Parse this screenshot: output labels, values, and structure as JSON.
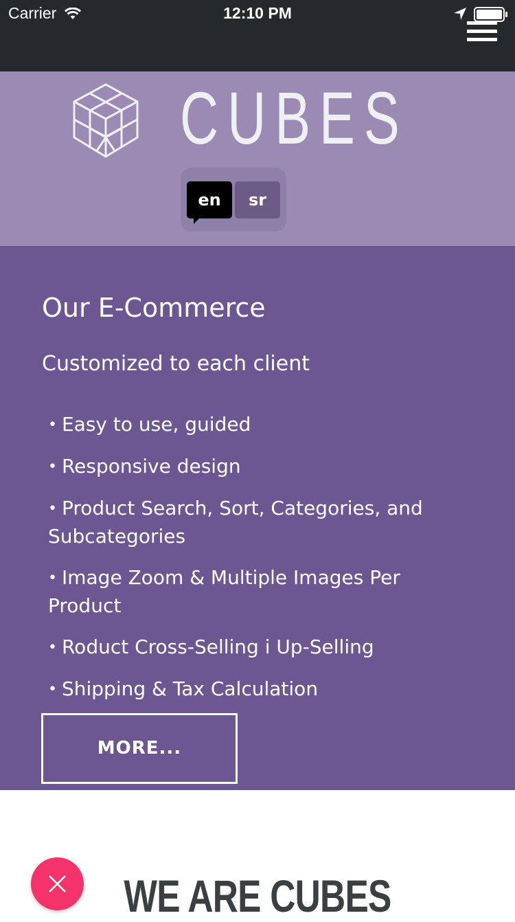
{
  "status": {
    "carrier": "Carrier",
    "time": "12:10 PM"
  },
  "header": {
    "brand": "CUBES",
    "languages": [
      "en",
      "sr"
    ],
    "active_language": "en"
  },
  "features": {
    "title": "Our E-Commerce",
    "subtitle": "Customized to each client",
    "items": [
      "Easy to use, guided",
      "Responsive design",
      "Product Search, Sort, Categories, and Subcategories",
      "Image Zoom & Multiple Images Per Product",
      "Roduct Cross-Selling i Up-Selling",
      "Shipping & Tax Calculation"
    ],
    "more_label": "MORE..."
  },
  "about": {
    "heading": "WE ARE CUBES"
  },
  "colors": {
    "status_bg": "#25292b",
    "hero_bg": "#9b8bb4",
    "features_bg": "#6c5792",
    "fab": "#f5336b"
  },
  "icons": [
    "wifi-icon",
    "location-arrow-icon",
    "battery-icon",
    "hamburger-menu-icon",
    "cube-logo-icon",
    "close-icon"
  ]
}
